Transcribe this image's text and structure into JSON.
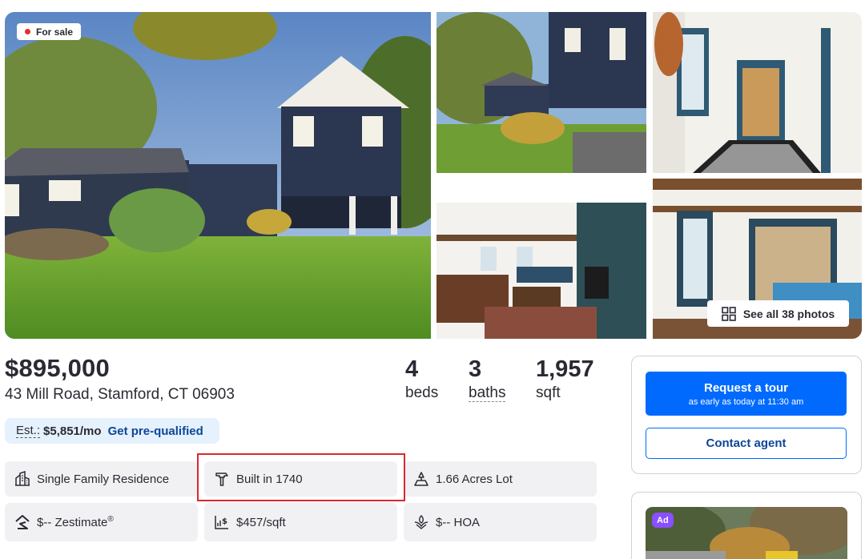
{
  "gallery": {
    "badge": "For sale",
    "see_all": "See all 38 photos",
    "badge_color": "#e42d2d"
  },
  "listing": {
    "price": "$895,000",
    "address": "43 Mill Road, Stamford, CT 06903",
    "beds": {
      "value": "4",
      "label": "beds"
    },
    "baths": {
      "value": "3",
      "label": "baths"
    },
    "sqft": {
      "value": "1,957",
      "label": "sqft"
    }
  },
  "estimate": {
    "label": "Est.:",
    "value": "$5,851/mo",
    "link": "Get pre-qualified"
  },
  "facts": {
    "type": "Single Family Residence",
    "built": "Built in 1740",
    "lot": "1.66 Acres Lot",
    "zestimate": "$-- Zestimate",
    "zestimate_mark": "®",
    "price_per_sqft": "$457/sqft",
    "hoa": "$-- HOA"
  },
  "agent_card": {
    "tour_button": "Request a tour",
    "tour_sub": "as early as today at 11:30 am",
    "contact_button": "Contact agent",
    "accent_color": "#006aff"
  },
  "ad": {
    "badge": "Ad"
  }
}
